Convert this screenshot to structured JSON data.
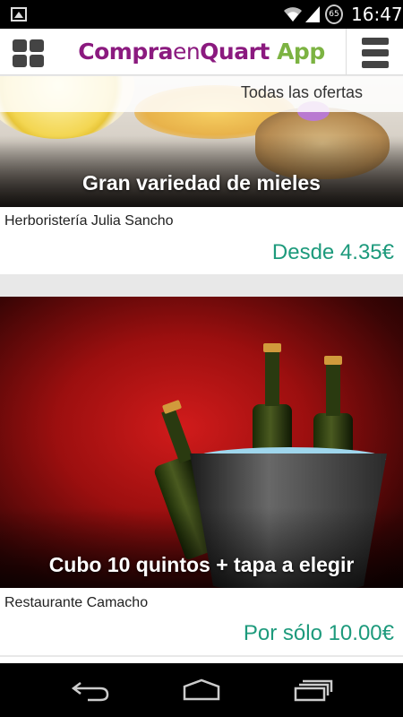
{
  "status_bar": {
    "clock": "16:47",
    "battery_level": "65",
    "icons": [
      "picture-icon",
      "wifi-icon",
      "signal-icon",
      "battery-icon"
    ]
  },
  "app_bar": {
    "title_part1": "Compra",
    "title_part2": "en",
    "title_part3": "Quart",
    "title_part4": " App",
    "left_icon": "grid-menu-icon",
    "right_icon": "hamburger-menu-icon",
    "brand_color": "#8b1a7f",
    "accent_color": "#7cb342"
  },
  "filter": {
    "label": "Todas las ofertas"
  },
  "offers": [
    {
      "caption": "Gran variedad de mieles",
      "store": "Herboristería Julia Sancho",
      "price": "Desde 4.35€"
    },
    {
      "caption": "Cubo 10 quintos + tapa a elegir",
      "store": "Restaurante Camacho",
      "price": "Por sólo 10.00€"
    }
  ],
  "price_color": "#1d9a7c",
  "nav_bar": {
    "icons": [
      "back-icon",
      "home-icon",
      "recents-icon"
    ]
  }
}
